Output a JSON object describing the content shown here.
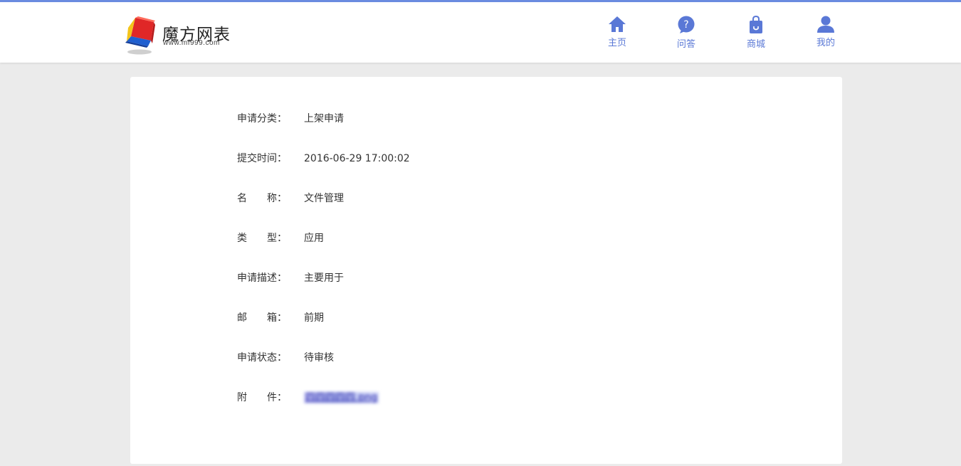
{
  "brand": {
    "title": "魔方网表",
    "url": "www.mf999.com"
  },
  "nav": [
    {
      "label": "主页",
      "icon": "home-icon"
    },
    {
      "label": "问答",
      "icon": "question-icon"
    },
    {
      "label": "商城",
      "icon": "shopping-bag-icon"
    },
    {
      "label": "我的",
      "icon": "user-icon"
    }
  ],
  "colors": {
    "accent": "#6a8be0",
    "nav_text": "#5a78d6",
    "background": "#ebebeb"
  },
  "details": [
    {
      "label": "申请分类：",
      "value": "上架申请"
    },
    {
      "label": "提交时间：",
      "value": "2016-06-29 17:00:02"
    },
    {
      "label": "名　　称：",
      "value": "文件管理"
    },
    {
      "label": "类　　型：",
      "value": "应用"
    },
    {
      "label": "申请描述：",
      "value": "主要用于"
    },
    {
      "label": "邮　　箱：",
      "value": "前期"
    },
    {
      "label": "申请状态：",
      "value": "待审核"
    },
    {
      "label": "附　　件：",
      "value": "四四四四四.png"
    }
  ]
}
